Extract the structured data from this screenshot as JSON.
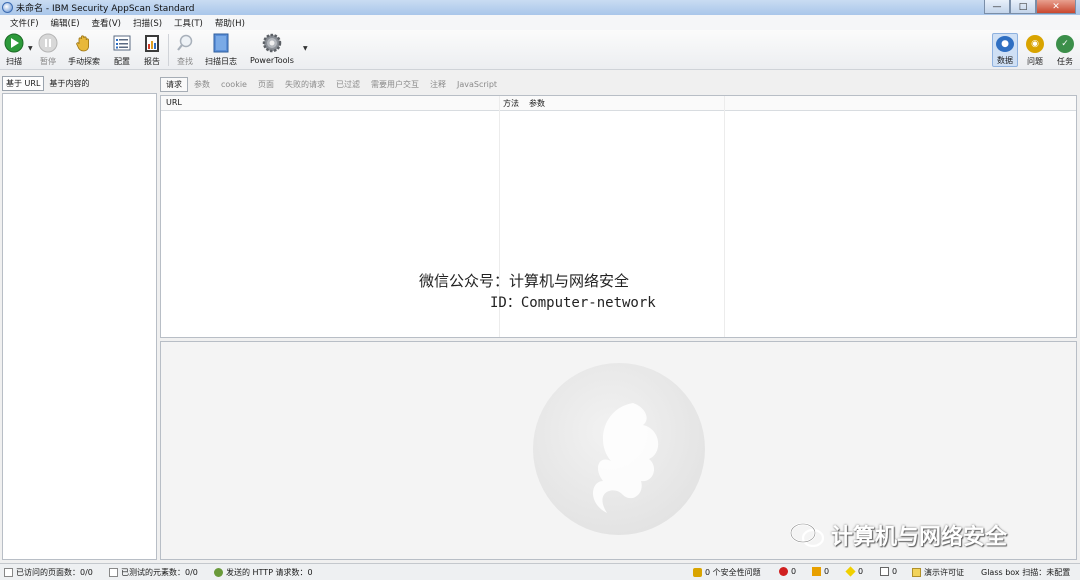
{
  "window": {
    "title": "未命名 - IBM Security AppScan Standard"
  },
  "menu": [
    "文件(F)",
    "编辑(E)",
    "查看(V)",
    "扫描(S)",
    "工具(T)",
    "帮助(H)"
  ],
  "toolbar": {
    "scan": "扫描",
    "pause": "暂停",
    "manual_explore": "手动探索",
    "config": "配置",
    "report": "报告",
    "find": "查找",
    "scan_log": "扫描日志",
    "powertools": "PowerTools",
    "data": "数据",
    "issues": "问题",
    "tasks": "任务"
  },
  "left_panel": {
    "tabs": [
      "基于 URL",
      "基于内容的"
    ]
  },
  "detail_tabs": [
    "请求",
    "参数",
    "cookie",
    "页面",
    "失败的请求",
    "已过滤",
    "需要用户交互",
    "注释",
    "JavaScript"
  ],
  "grid": {
    "columns": [
      "URL",
      "方法",
      "参数"
    ]
  },
  "overlay": {
    "line1": "微信公众号：计算机与网络安全",
    "line2": "ID：Computer-network"
  },
  "watermark": {
    "text": "计算机与网络安全"
  },
  "status": {
    "visited_pages": "已访问的页面数：0/0",
    "tested_elements": "已测试的元素数：0/0",
    "http_requests": "发送的 HTTP 请求数：0",
    "security_issues": "0 个安全性问题",
    "high": "0",
    "medium": "0",
    "low": "0",
    "info": "0",
    "license": "演示许可证",
    "glassbox": "Glass box 扫描：未配置"
  },
  "colors": {
    "accent": "#2f6fc2",
    "play": "#2d9a3a",
    "tasks_check": "#3c8f4a"
  }
}
